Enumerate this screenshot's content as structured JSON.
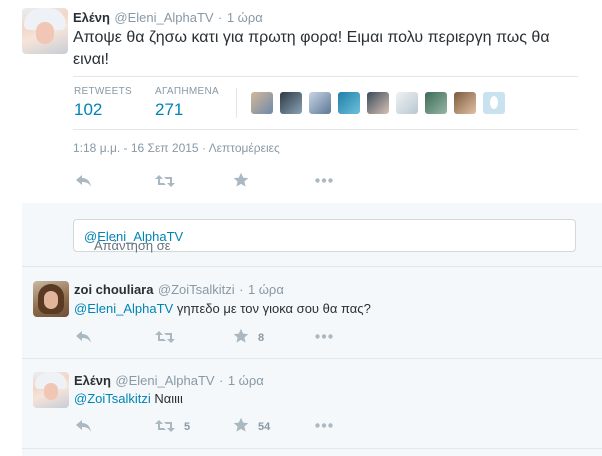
{
  "main_tweet": {
    "name": "Ελένη",
    "handle": "@Eleni_AlphaTV",
    "separator": "·",
    "time": "1 ώρα",
    "text": "Αποψε θα ζησω κατι για πρωτη φορα! Ειμαι πολυ περιεργη πως θα ειναι!",
    "retweets_label": "RETWEETS",
    "retweets_count": "102",
    "favorites_label": "ΑΓΑΠΗΜΕΝΑ",
    "favorites_count": "271",
    "timestamp": "1:18 μ.μ. - 16 Σεπ 2015",
    "details_link": "Λεπτομέρειες",
    "actions": {
      "reply_icon": "reply-icon",
      "retweet_icon": "retweet-icon",
      "favorite_icon": "star-icon",
      "more_icon": "more-icon"
    }
  },
  "reply_box": {
    "prefix": "Απάντηση σε ",
    "mention": "@Eleni_AlphaTV"
  },
  "replies": [
    {
      "name": "zoi chouliara",
      "handle": "@ZoiTsalkitzi",
      "separator": "·",
      "time": "1 ώρα",
      "mention": "@Eleni_AlphaTV",
      "text": " γηπεδο με τον γιοκα σου θα πας?",
      "retweet_count": "",
      "favorite_count": "8"
    },
    {
      "name": "Ελένη",
      "handle": "@Eleni_AlphaTV",
      "separator": "·",
      "time": "1 ώρα",
      "mention": "@ZoiTsalkitzi",
      "text": " Ναιιιι",
      "retweet_count": "5",
      "favorite_count": "54"
    }
  ],
  "colors": {
    "link": "#0084b4",
    "muted": "#8899a6",
    "text": "#292f33",
    "border": "#e1e8ed",
    "panel": "#f5f8fa"
  }
}
